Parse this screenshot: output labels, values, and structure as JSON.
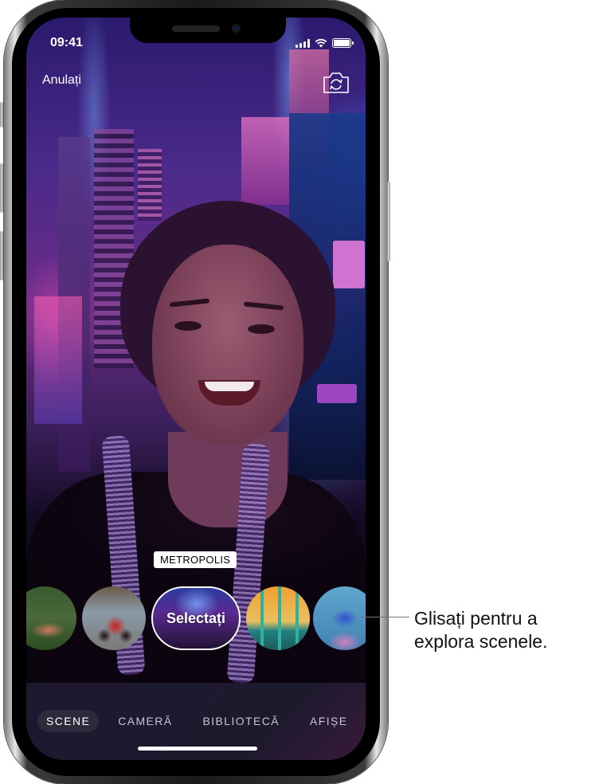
{
  "status_bar": {
    "time": "09:41",
    "icons": [
      "cellular-signal-icon",
      "wifi-icon",
      "battery-icon"
    ]
  },
  "header": {
    "cancel_label": "Anulați",
    "flip_camera_icon": "camera-flip-icon"
  },
  "scene_picker": {
    "current_scene_name": "METROPOLIS",
    "select_label": "Selectați",
    "thumbnails": [
      {
        "name": "forest-deer-scene"
      },
      {
        "name": "incredibles-scene"
      },
      {
        "name": "metropolis-scene",
        "selected": true
      },
      {
        "name": "bridge-scene"
      },
      {
        "name": "finding-dory-scene"
      }
    ]
  },
  "tabs": [
    {
      "label": "SCENE",
      "active": true
    },
    {
      "label": "CAMERĂ",
      "active": false
    },
    {
      "label": "BIBLIOTECĂ",
      "active": false
    },
    {
      "label": "AFIȘE",
      "active": false
    }
  ],
  "callout": {
    "line1": "Glisați pentru a",
    "line2": "explora scenele."
  },
  "colors": {
    "tabbar_bg": "#1e1a2e",
    "active_tab_bg": "#2d2a3c",
    "label_bg": "#ffffff"
  }
}
